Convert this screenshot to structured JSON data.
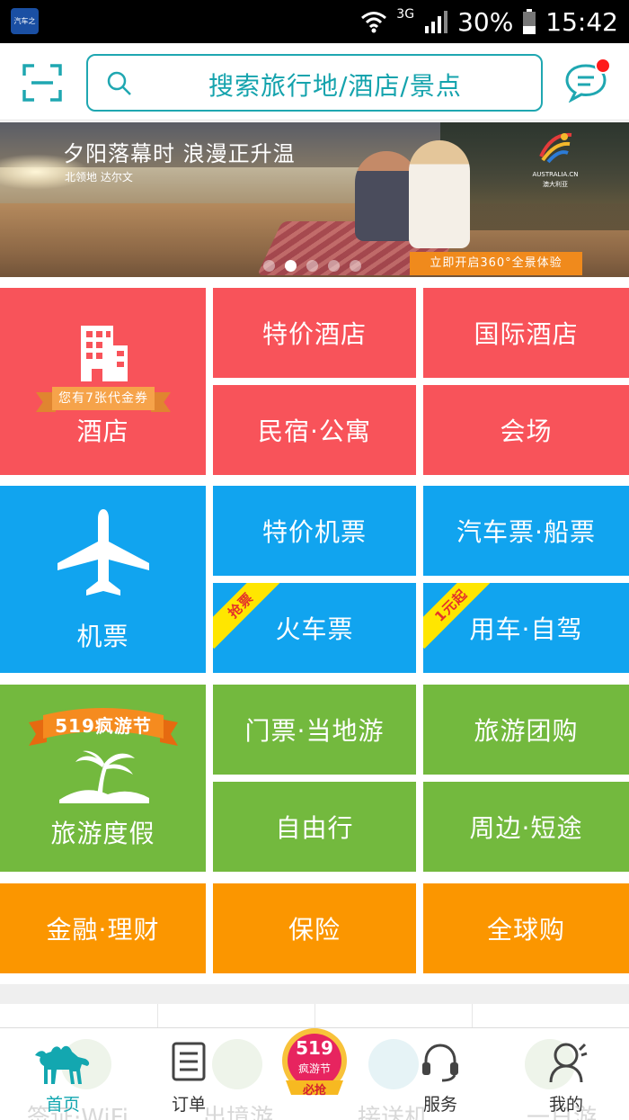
{
  "status_bar": {
    "app_icon_text": "汽车之家",
    "network": "3G",
    "battery": "30%",
    "time": "15:42"
  },
  "header": {
    "search_placeholder": "搜索旅行地/酒店/景点",
    "icons": {
      "scan": "scan-icon",
      "search": "search-icon",
      "message": "message-icon"
    }
  },
  "banner": {
    "title": "夕阳落幕时 浪漫正升温",
    "subtitle": "北领地 达尔文",
    "logo_text": "AUSTRALIA.CN",
    "logo_sub": "澳大利亚",
    "cta": "立即开启360°全景体验",
    "dots": 5,
    "active_dot": 1
  },
  "grid": {
    "hotel": {
      "label": "酒店",
      "coupon": "您有7张代金券",
      "items": [
        "特价酒店",
        "国际酒店",
        "民宿·公寓",
        "会场"
      ]
    },
    "flight": {
      "label": "机票",
      "items": [
        "特价机票",
        "汽车票·船票",
        "火车票",
        "用车·自驾"
      ],
      "badges": {
        "train": "抢票",
        "car": "1元起"
      }
    },
    "vacation": {
      "label": "旅游度假",
      "festival": "519疯游节",
      "items": [
        "门票·当地游",
        "旅游团购",
        "自由行",
        "周边·短途"
      ]
    },
    "other": [
      "金融·理财",
      "保险",
      "全球购"
    ]
  },
  "tabbar": {
    "items": [
      {
        "label": "首页",
        "icon": "camel-icon",
        "active": true
      },
      {
        "label": "订单",
        "icon": "order-icon",
        "active": false
      },
      {
        "label": "",
        "icon": "festival-519-icon",
        "badge_top": "519",
        "badge_mid": "疯游节",
        "badge_bottom": "必抢",
        "active": false
      },
      {
        "label": "服务",
        "icon": "headset-icon",
        "active": false
      },
      {
        "label": "我的",
        "icon": "profile-icon",
        "active": false
      }
    ],
    "ghost_labels": [
      "签证·WiFi",
      "出境游",
      "接送机",
      "一日游"
    ]
  },
  "colors": {
    "accent": "#13a7b0",
    "hotel": "#f8535a",
    "flight": "#11a4ef",
    "vacation": "#73b93e",
    "other": "#fb9600"
  }
}
